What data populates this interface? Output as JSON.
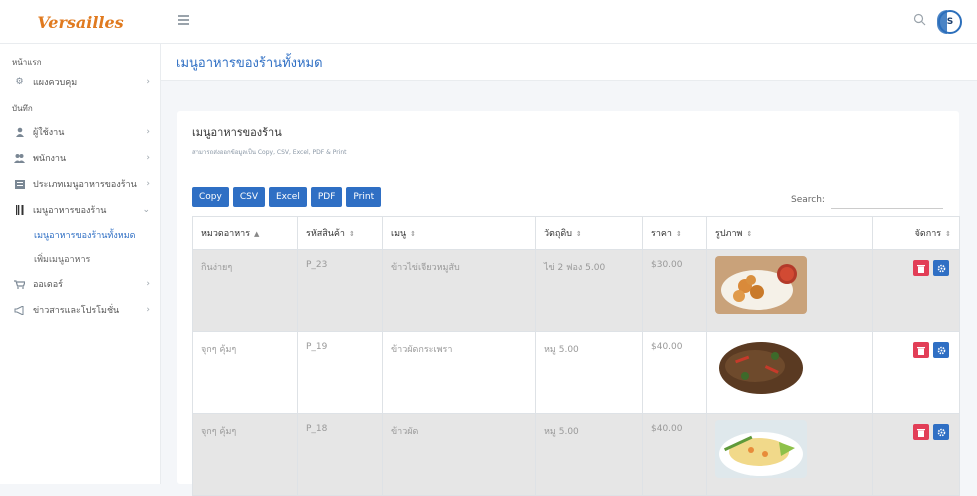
{
  "app": {
    "brand": "Versailles"
  },
  "sidebar": {
    "sections": [
      {
        "heading": "หน้าแรก",
        "items": [
          {
            "label": "แผงควบคุม",
            "icon": "dashboard-icon"
          }
        ]
      },
      {
        "heading": "บันทึก",
        "items": [
          {
            "label": "ผู้ใช้งาน",
            "icon": "user-icon"
          },
          {
            "label": "พนักงาน",
            "icon": "users-icon"
          },
          {
            "label": "ประเภทเมนูอาหารของร้าน",
            "icon": "list-icon"
          },
          {
            "label": "เมนูอาหารของร้าน",
            "icon": "cutlery-icon"
          }
        ]
      }
    ],
    "submenu": [
      "เมนูอาหารของร้านทั้งหมด",
      "เพิ่มเมนูอาหาร"
    ],
    "bottom_items": [
      {
        "label": "ออเดอร์",
        "icon": "cart-icon"
      },
      {
        "label": "ข่าวสารและโปรโมชั่น",
        "icon": "megaphone-icon"
      }
    ]
  },
  "page": {
    "title": "เมนูอาหารของร้านทั้งหมด"
  },
  "card": {
    "title": "เมนูอาหารของร้าน",
    "subtitle": "สามารถส่งออกข้อมูลเป็น Copy, CSV, Excel, PDF & Print"
  },
  "toolbar": {
    "buttons": [
      "Copy",
      "CSV",
      "Excel",
      "PDF",
      "Print"
    ]
  },
  "search": {
    "label": "Search:",
    "value": ""
  },
  "table": {
    "headers": [
      "หมวดอาหาร",
      "รหัสสินค้า",
      "เมนู",
      "วัตถุดิบ",
      "ราคา",
      "รูปภาพ",
      "จัดการ"
    ],
    "sort_active": "▲",
    "sort_idle": "⇕",
    "rows": [
      {
        "category": "กินง่ายๆ",
        "code": "P_23",
        "menu": "ข้าวไข่เจียวหมูสับ",
        "ingredient": "ไข่ 2 ฟอง 5.00",
        "price": "$30.00",
        "image": "fried-chicken-rice"
      },
      {
        "category": "จุกๆ คุ้มๆ",
        "code": "P_19",
        "menu": "ข้าวผัดกระเพรา",
        "ingredient": "หมู 5.00",
        "price": "$40.00",
        "image": "stir-fried-basil"
      },
      {
        "category": "จุกๆ คุ้มๆ",
        "code": "P_18",
        "menu": "ข้าวผัด",
        "ingredient": "หมู 5.00",
        "price": "$40.00",
        "image": "fried-rice"
      }
    ]
  },
  "colors": {
    "brand": "#e07a1f",
    "accent": "#2f6fc4",
    "danger": "#e23e57"
  }
}
